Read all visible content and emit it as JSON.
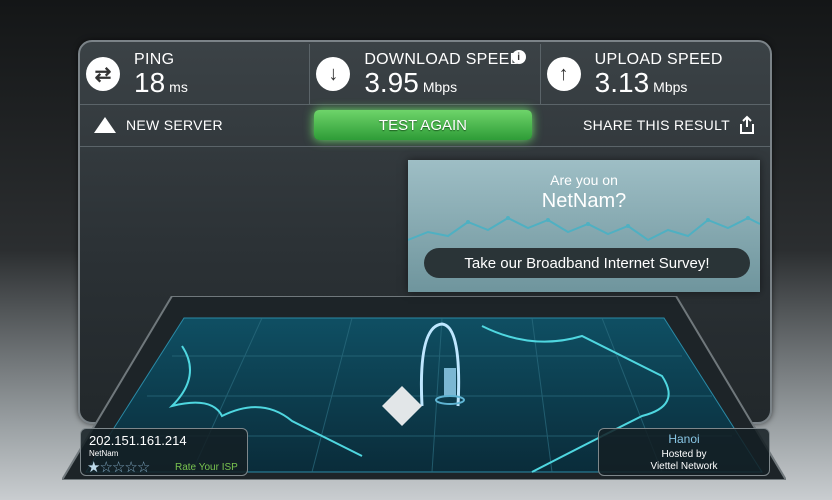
{
  "stats": {
    "ping": {
      "label": "PING",
      "value": "18",
      "unit": "ms",
      "icon": "ping-icon"
    },
    "download": {
      "label": "DOWNLOAD SPEED",
      "value": "3.95",
      "unit": "Mbps",
      "icon": "download-icon"
    },
    "upload": {
      "label": "UPLOAD SPEED",
      "value": "3.13",
      "unit": "Mbps",
      "icon": "upload-icon"
    }
  },
  "actions": {
    "new_server": "NEW SERVER",
    "test_again": "TEST AGAIN",
    "share": "SHARE THIS RESULT"
  },
  "survey": {
    "question_line1": "Are you on",
    "isp_name": "NetNam?",
    "cta": "Take our Broadband Internet Survey!"
  },
  "client": {
    "ip": "202.151.161.214",
    "isp": "NetNam",
    "rating": 1,
    "rating_max": 5,
    "rate_label": "Rate Your ISP"
  },
  "server": {
    "city": "Hanoi",
    "hosted_by_label": "Hosted by",
    "network": "Viettel Network"
  },
  "colors": {
    "accent_green": "#6ed46a",
    "map_glow": "#4fd7e0",
    "city_text": "#88c6e4",
    "rate_text": "#79c34f"
  }
}
